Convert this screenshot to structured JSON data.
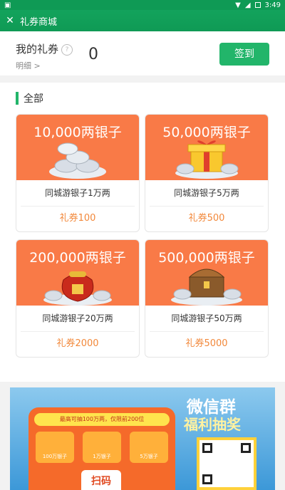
{
  "statusbar": {
    "time": "3:49"
  },
  "titlebar": {
    "close": "✕",
    "title": "礼券商城"
  },
  "header": {
    "label": "我的礼券",
    "help_icon": "?",
    "detail": "明细 >",
    "count": "0",
    "signin": "签到"
  },
  "section": {
    "title": "全部"
  },
  "cards": [
    {
      "amount": "10,000两银子",
      "name": "同城游银子1万两",
      "price": "礼券100"
    },
    {
      "amount": "50,000两银子",
      "name": "同城游银子5万两",
      "price": "礼券500"
    },
    {
      "amount": "200,000两银子",
      "name": "同城游银子20万两",
      "price": "礼券2000"
    },
    {
      "amount": "500,000两银子",
      "name": "同城游银子50万两",
      "price": "礼券5000"
    }
  ],
  "banner": {
    "line1": "微信群",
    "line2": "福利抽奖",
    "pill": "最高可抽100万两，仅限前200位",
    "tiles": [
      "100万银子",
      "1万银子",
      "5万银子"
    ],
    "scan": "扫码"
  }
}
